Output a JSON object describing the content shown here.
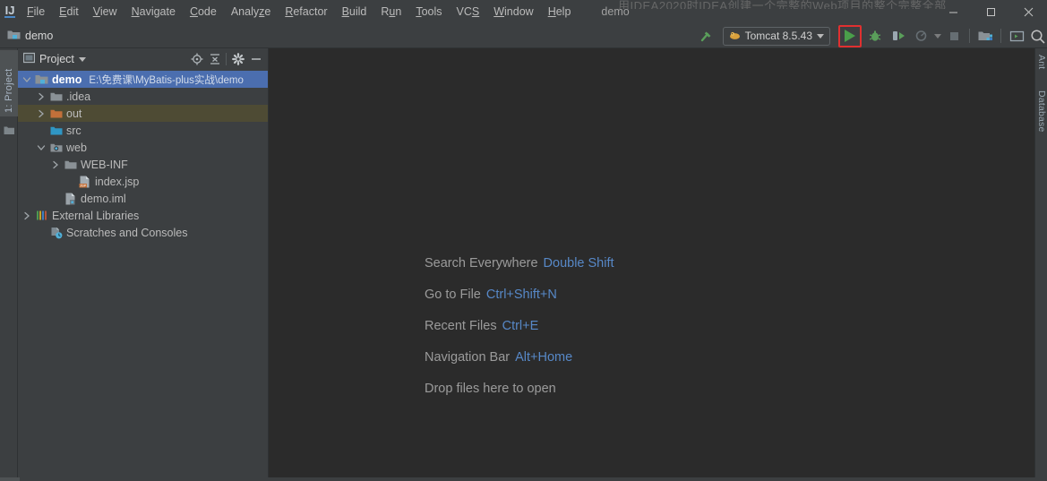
{
  "window": {
    "title": "demo",
    "watermark_text": "用IDEA2020时IDEA创建一个完整的Web项目的整个完整全部",
    "controls": {
      "minimize": "—",
      "maximize": "□",
      "close": "✕"
    }
  },
  "menubar": {
    "logo": "IJ",
    "items": [
      {
        "label": "File",
        "mnemonic": "F"
      },
      {
        "label": "Edit",
        "mnemonic": "E"
      },
      {
        "label": "View",
        "mnemonic": "V"
      },
      {
        "label": "Navigate",
        "mnemonic": "N"
      },
      {
        "label": "Code",
        "mnemonic": "C"
      },
      {
        "label": "Analyze",
        "mnemonic": "z"
      },
      {
        "label": "Refactor",
        "mnemonic": "R"
      },
      {
        "label": "Build",
        "mnemonic": "B"
      },
      {
        "label": "Run",
        "mnemonic": "u"
      },
      {
        "label": "Tools",
        "mnemonic": "T"
      },
      {
        "label": "VCS",
        "mnemonic": "S"
      },
      {
        "label": "Window",
        "mnemonic": "W"
      },
      {
        "label": "Help",
        "mnemonic": "H"
      }
    ]
  },
  "navbar": {
    "breadcrumb": "demo",
    "toolbar": {
      "build_icon": "hammer-icon",
      "run_configuration": "Tomcat 8.5.43",
      "run_label": "run-icon",
      "debug_label": "debug-icon",
      "run_coverage_label": "run-with-coverage-icon",
      "profile_label": "profiler-icon",
      "stop_label": "stop-icon",
      "project_structure_label": "project-structure-icon",
      "terminal_label": "terminal-icon",
      "search_label": "search-icon"
    }
  },
  "left_stripe": {
    "project_tab": "1: Project",
    "structure_icon": "structure-icon"
  },
  "right_stripe": {
    "tabs": [
      "Ant",
      "Database"
    ]
  },
  "project_panel": {
    "title": "Project",
    "actions": [
      {
        "name": "select-opened-file-icon",
        "label": "Select Opened File"
      },
      {
        "name": "collapse-all-icon",
        "label": "Collapse All"
      },
      {
        "name": "settings-gear-icon",
        "label": "Settings"
      },
      {
        "name": "hide-icon",
        "label": "Hide"
      }
    ],
    "tree": [
      {
        "label": "demo",
        "sub": "E:\\免费课\\MyBatis-plus实战\\demo",
        "indent": 0,
        "arrow": "down",
        "icon": "project-folder",
        "state": "selected"
      },
      {
        "label": ".idea",
        "sub": "",
        "indent": 1,
        "arrow": "right",
        "icon": "folder-gray",
        "state": "normal"
      },
      {
        "label": "out",
        "sub": "",
        "indent": 1,
        "arrow": "right",
        "icon": "folder-orange",
        "state": "hover"
      },
      {
        "label": "src",
        "sub": "",
        "indent": 1,
        "arrow": "none",
        "icon": "folder-source",
        "state": "normal"
      },
      {
        "label": "web",
        "sub": "",
        "indent": 1,
        "arrow": "down",
        "icon": "folder-web",
        "state": "normal"
      },
      {
        "label": "WEB-INF",
        "sub": "",
        "indent": 2,
        "arrow": "right",
        "icon": "folder-gray",
        "state": "normal"
      },
      {
        "label": "index.jsp",
        "sub": "",
        "indent": 3,
        "arrow": "none",
        "icon": "file-jsp",
        "state": "normal"
      },
      {
        "label": "demo.iml",
        "sub": "",
        "indent": 2,
        "arrow": "none",
        "icon": "file-iml",
        "state": "normal"
      },
      {
        "label": "External Libraries",
        "sub": "",
        "indent": 0,
        "arrow": "right",
        "icon": "libraries",
        "state": "normal"
      },
      {
        "label": "Scratches and Consoles",
        "sub": "",
        "indent": 1,
        "arrow": "none",
        "icon": "scratches",
        "state": "normal"
      }
    ]
  },
  "editor": {
    "hints": [
      {
        "text": "Search Everywhere",
        "key": "Double Shift"
      },
      {
        "text": "Go to File",
        "key": "Ctrl+Shift+N"
      },
      {
        "text": "Recent Files",
        "key": "Ctrl+E"
      },
      {
        "text": "Navigation Bar",
        "key": "Alt+Home"
      },
      {
        "text": "Drop files here to open",
        "key": ""
      }
    ]
  },
  "colors": {
    "panel_bg": "#3c3f41",
    "editor_bg": "#2b2b2b",
    "selection_blue": "#4b6eaf",
    "hover_olive": "#4e4b34",
    "key_blue": "#5788c7",
    "run_green": "#4a9e4a",
    "highlight_red": "#e03030"
  }
}
